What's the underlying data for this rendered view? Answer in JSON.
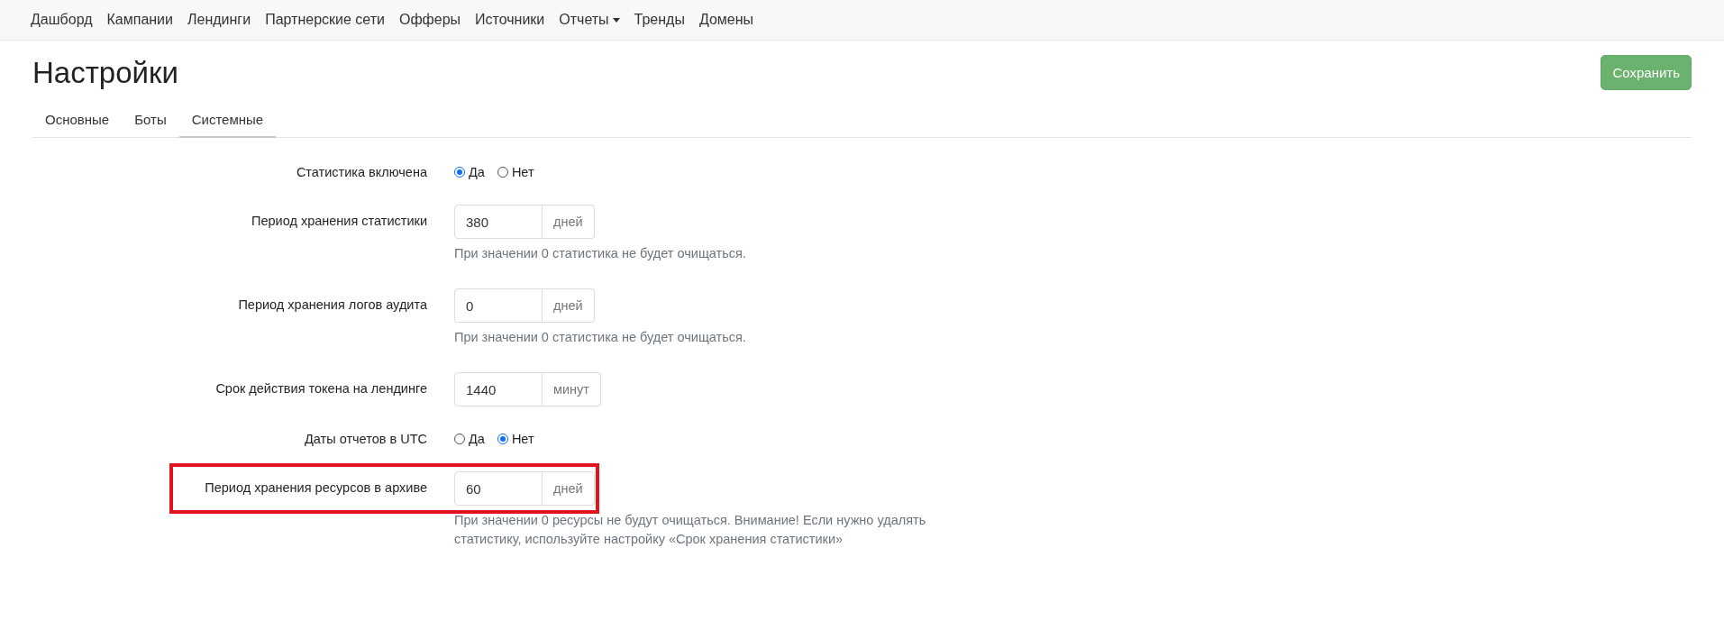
{
  "navbar": {
    "items": [
      {
        "label": "Дашборд",
        "dropdown": false
      },
      {
        "label": "Кампании",
        "dropdown": false
      },
      {
        "label": "Лендинги",
        "dropdown": false
      },
      {
        "label": "Партнерские сети",
        "dropdown": false
      },
      {
        "label": "Офферы",
        "dropdown": false
      },
      {
        "label": "Источники",
        "dropdown": false
      },
      {
        "label": "Отчеты",
        "dropdown": true
      },
      {
        "label": "Тренды",
        "dropdown": false
      },
      {
        "label": "Домены",
        "dropdown": false
      }
    ]
  },
  "page": {
    "title": "Настройки",
    "save_button": "Сохранить"
  },
  "tabs": [
    {
      "label": "Основные",
      "selected": false
    },
    {
      "label": "Боты",
      "selected": false
    },
    {
      "label": "Системные",
      "selected": true
    }
  ],
  "form": [
    {
      "kind": "radio",
      "label": "Статистика включена",
      "highlighted": false,
      "options": [
        {
          "label": "Да",
          "selected": true
        },
        {
          "label": "Нет",
          "selected": false
        }
      ]
    },
    {
      "kind": "number",
      "label": "Период хранения статистики",
      "highlighted": false,
      "value": "380",
      "unit": "дней",
      "help": "При значении 0 статистика не будет очищаться."
    },
    {
      "kind": "number",
      "label": "Период хранения логов аудита",
      "highlighted": false,
      "value": "0",
      "unit": "дней",
      "help": "При значении 0 статистика не будет очищаться."
    },
    {
      "kind": "number",
      "label": "Срок действия токена на лендинге",
      "highlighted": false,
      "value": "1440",
      "unit": "минут"
    },
    {
      "kind": "radio",
      "label": "Даты отчетов в UTC",
      "highlighted": false,
      "options": [
        {
          "label": "Да",
          "selected": false
        },
        {
          "label": "Нет",
          "selected": true
        }
      ]
    },
    {
      "kind": "number",
      "label": "Период хранения ресурсов в архиве",
      "highlighted": true,
      "value": "60",
      "unit": "дней",
      "help": "При значении 0 ресурсы не будут очищаться. Внимание! Если нужно удалять статистику, используйте настройку «Срок хранения статистики»"
    }
  ]
}
